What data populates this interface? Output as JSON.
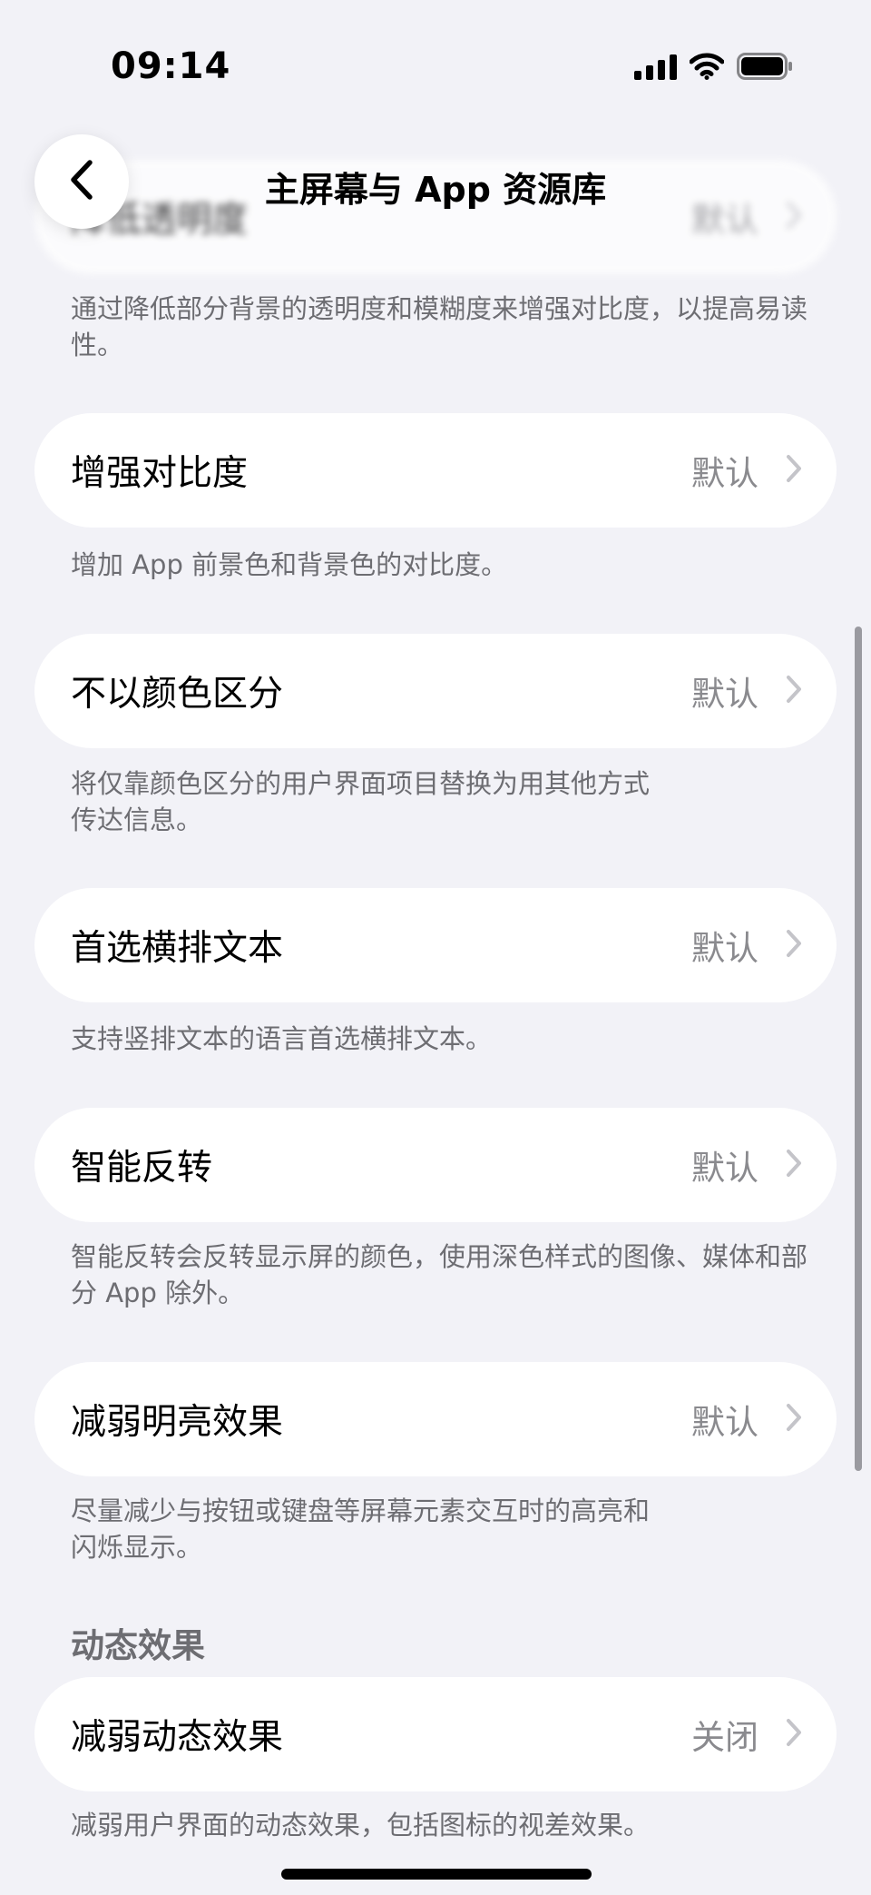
{
  "status_bar": {
    "time": "09:14",
    "icons": [
      "signal-icon",
      "wifi-icon",
      "battery-icon"
    ]
  },
  "nav": {
    "title": "主屏幕与 App 资源库",
    "back_icon": "chevron-left-icon"
  },
  "rows": [
    {
      "title": "降低透明度",
      "value": "默认",
      "footer": "通过降低部分背景的透明度和模糊度来增强对比度，以提高易读性。"
    },
    {
      "title": "增强对比度",
      "value": "默认",
      "footer": "增加 App 前景色和背景色的对比度。"
    },
    {
      "title": "不以颜色区分",
      "value": "默认",
      "footer_lines": [
        "将仅靠颜色区分的用户界面项目替换为用其他方式",
        "传达信息。"
      ]
    },
    {
      "title": "首选横排文本",
      "value": "默认",
      "footer": "支持竖排文本的语言首选横排文本。"
    },
    {
      "title": "智能反转",
      "value": "默认",
      "footer": "智能反转会反转显示屏的颜色，使用深色样式的图像、媒体和部分 App 除外。"
    },
    {
      "title": "减弱明亮效果",
      "value": "默认",
      "footer_lines": [
        "尽量减少与按钮或键盘等屏幕元素交互时的高亮和",
        "闪烁显示。"
      ]
    }
  ],
  "section_motion": {
    "header": "动态效果",
    "rows": [
      {
        "title": "减弱动态效果",
        "value": "关闭",
        "footer": "减弱用户界面的动态效果，包括图标的视差效果。"
      }
    ]
  },
  "colors": {
    "background": "#f2f2f7",
    "card": "#ffffff",
    "secondary_text": "#8a8a8e",
    "footer_text": "#6d6d72"
  }
}
